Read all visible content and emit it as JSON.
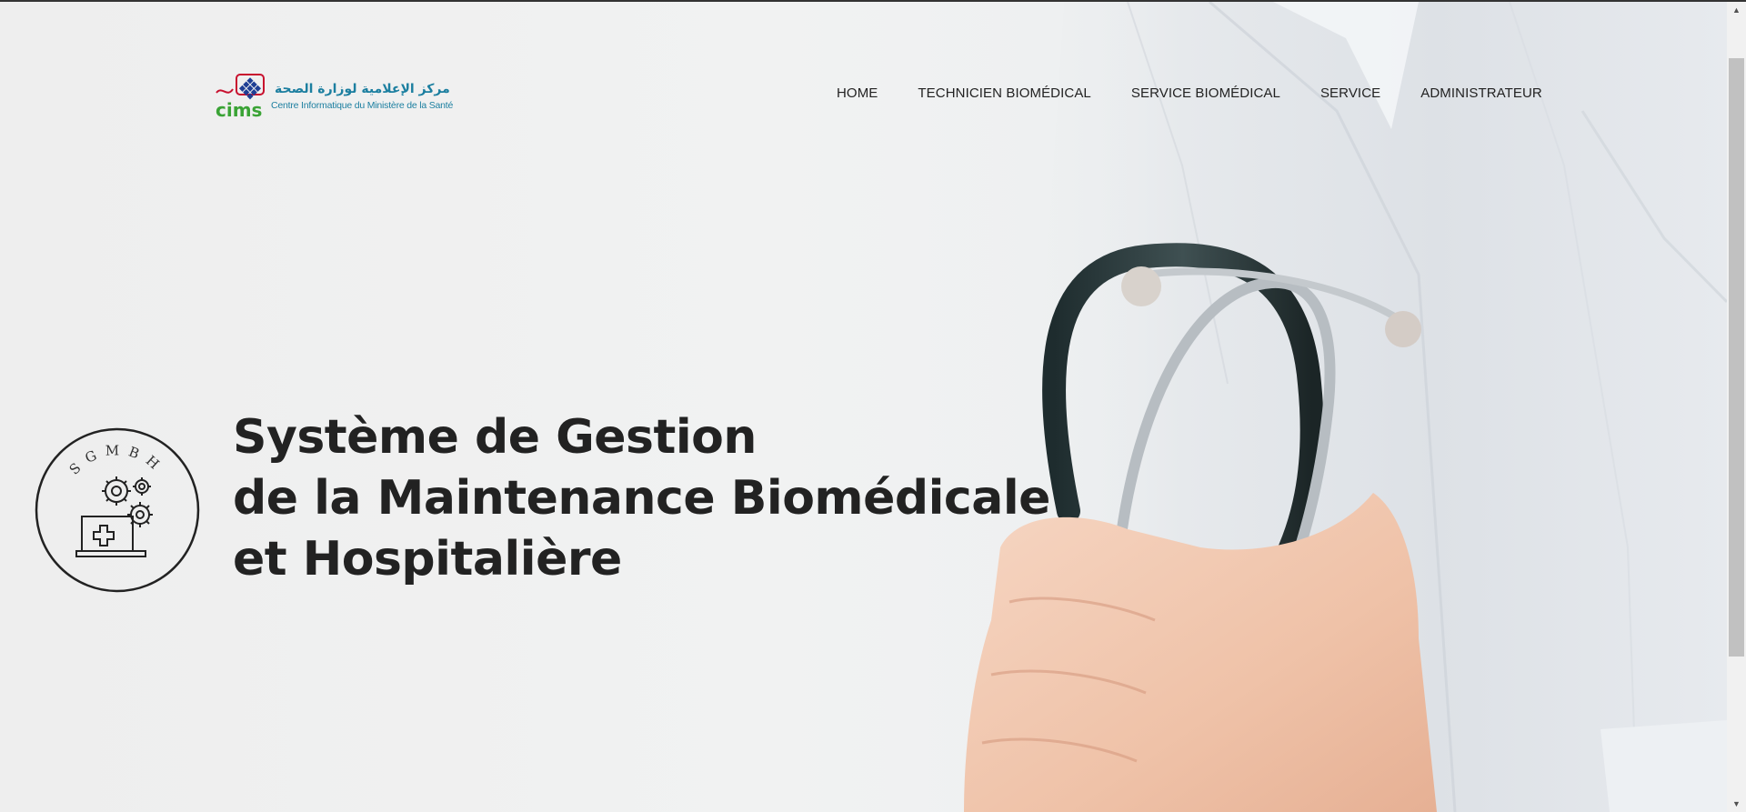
{
  "header": {
    "logo": {
      "arabic_text": "مركز الإعلامية لوزارة الصحة",
      "latin_text": "Centre Informatique du Ministère de la Santé",
      "acronym": "cims"
    },
    "nav": [
      {
        "label": "HOME"
      },
      {
        "label": "TECHNICIEN BIOMÉDICAL"
      },
      {
        "label": "SERVICE BIOMÉDICAL"
      },
      {
        "label": "SERVICE"
      },
      {
        "label": "ADMINISTRATEUR"
      }
    ]
  },
  "hero": {
    "emblem_text": "SGMBH",
    "title_lines": [
      "Système de Gestion",
      "de la Maintenance Biomédicale",
      "et Hospitalière"
    ],
    "background_icon": "doctor-stethoscope-photo"
  },
  "colors": {
    "text": "#222222",
    "logo_blue": "#1c7fa0",
    "logo_green": "#3aa335",
    "logo_red": "#c8102e",
    "logo_navy": "#1f3f94"
  }
}
